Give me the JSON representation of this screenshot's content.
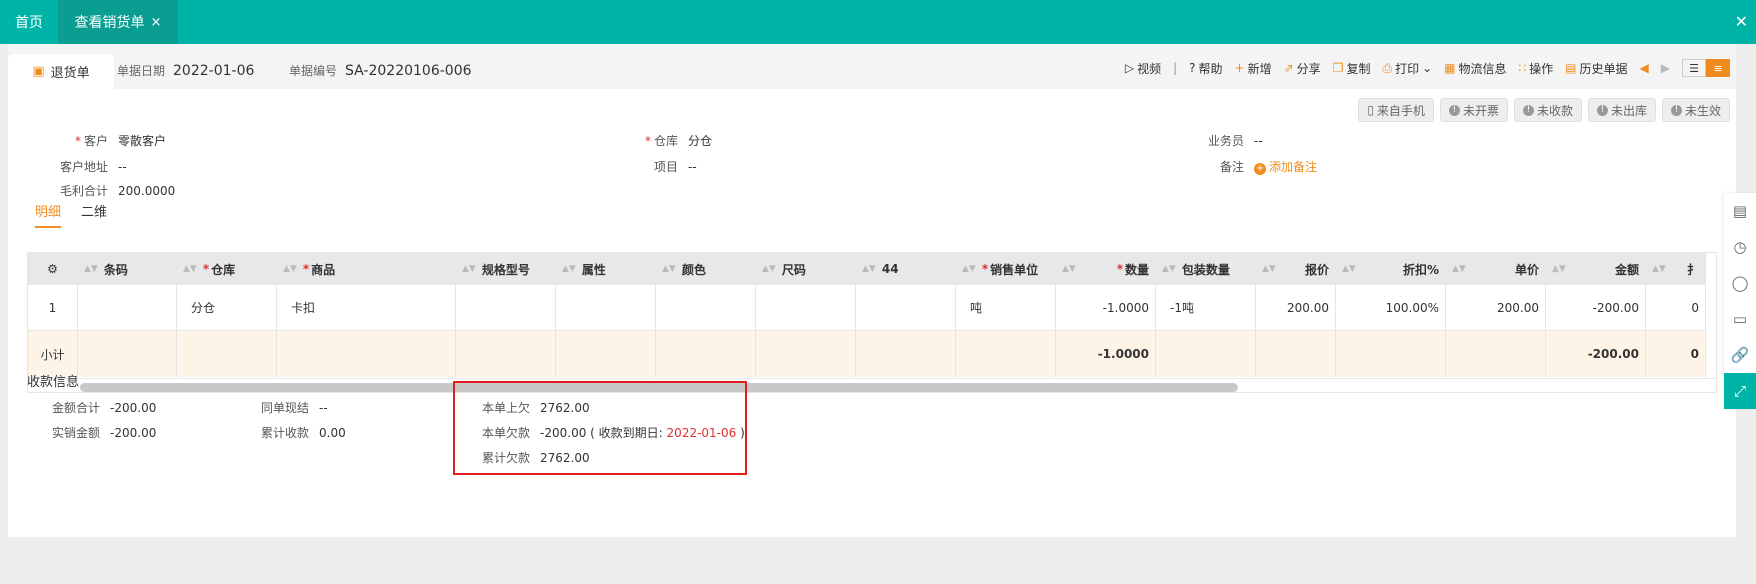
{
  "topbar": {
    "home": "首页",
    "tab": "查看销货单",
    "tab_close": "×",
    "close": "✕"
  },
  "doc": {
    "tab_label": "退货单",
    "date_label": "单据日期",
    "date_value": "2022-01-06",
    "no_label": "单据编号",
    "no_value": "SA-20220106-006"
  },
  "toolbar": {
    "video": "视频",
    "help": "帮助",
    "add": "新增",
    "share": "分享",
    "copy": "复制",
    "print": "打印",
    "logistics": "物流信息",
    "operate": "操作",
    "history": "历史单据"
  },
  "status": [
    "来自手机",
    "未开票",
    "未收款",
    "未出库",
    "未生效"
  ],
  "fields": {
    "customer_label": "客户",
    "customer_value": "零散客户",
    "warehouse_label": "仓库",
    "warehouse_value": "分仓",
    "salesman_label": "业务员",
    "salesman_value": "--",
    "address_label": "客户地址",
    "address_value": "--",
    "project_label": "项目",
    "project_value": "--",
    "note_label": "备注",
    "note_action": "添加备注",
    "profit_label": "毛利合计",
    "profit_value": "200.0000"
  },
  "detail_tabs": [
    "明细",
    "二维"
  ],
  "grid": {
    "headers": [
      "条码",
      "仓库",
      "商品",
      "规格型号",
      "属性",
      "颜色",
      "尺码",
      "44",
      "销售单位",
      "数量",
      "包装数量",
      "报价",
      "折扣%",
      "单价",
      "金额",
      "扌"
    ],
    "row": {
      "index": "1",
      "barcode": "",
      "warehouse": "分仓",
      "product": "卡扣",
      "spec": "",
      "attr": "",
      "color": "",
      "size": "",
      "c44": "",
      "unit": "吨",
      "qty": "-1.0000",
      "pack_qty": "-1吨",
      "quote": "200.00",
      "discount": "100.00%",
      "price": "200.00",
      "amount": "-200.00",
      "extra": "0"
    },
    "subtotal": {
      "label": "小计",
      "qty": "-1.0000",
      "amount": "-200.00",
      "extra": "0"
    }
  },
  "payment": {
    "title": "收款信息",
    "total_label": "金额合计",
    "total_value": "-200.00",
    "actual_label": "实销金额",
    "actual_value": "-200.00",
    "settle_label": "同单现结",
    "settle_value": "--",
    "cumulative_label": "累计收款",
    "cumulative_value": "0.00",
    "prev_debt_label": "本单上欠",
    "prev_debt_value": "2762.00",
    "debt_label": "本单欠款",
    "debt_value": "-200.00",
    "due_prefix": "( 收款到期日:",
    "due_date": "2022-01-06",
    "due_suffix": ")",
    "total_debt_label": "累计欠款",
    "total_debt_value": "2762.00"
  },
  "colors": {
    "teal": "#00b3a7",
    "orange": "#f08c1e",
    "red": "#e03030"
  }
}
